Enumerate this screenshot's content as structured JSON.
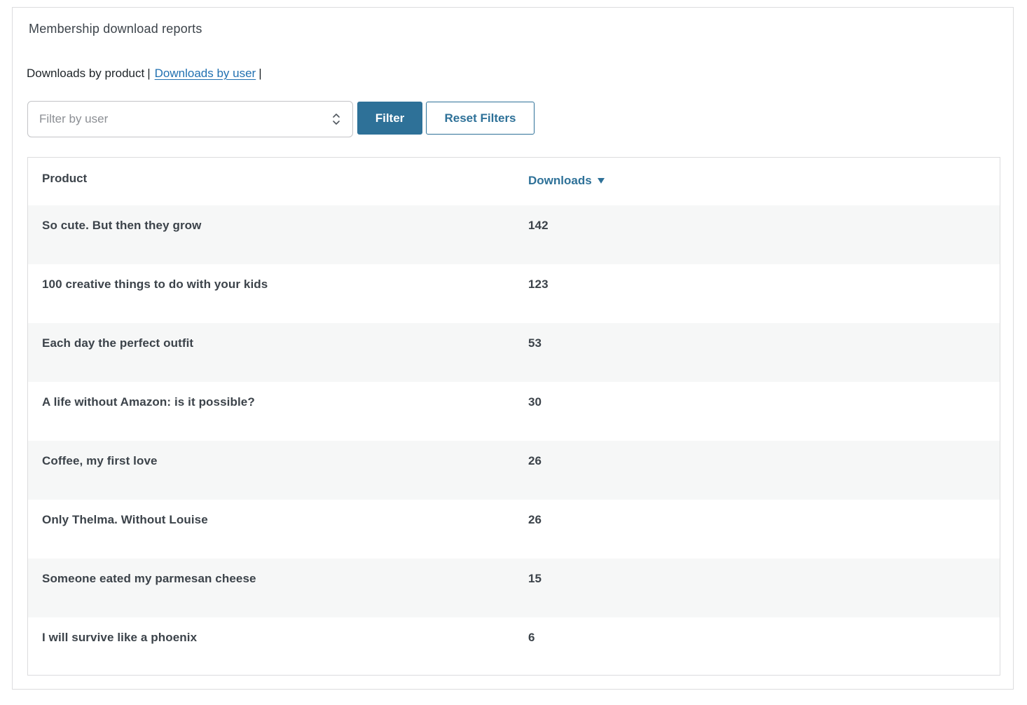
{
  "report": {
    "title": "Membership download reports"
  },
  "tabs": {
    "by_product": "Downloads by product",
    "separator": "|",
    "by_user": "Downloads by user",
    "trailing_separator": "|"
  },
  "filters": {
    "user_placeholder": "Filter by user",
    "filter_label": "Filter",
    "reset_label": "Reset Filters"
  },
  "table": {
    "columns": {
      "product": "Product",
      "downloads": "Downloads"
    },
    "sort": {
      "column": "downloads",
      "direction": "descending",
      "icon": "caret-down-icon"
    },
    "rows": [
      {
        "product": "So cute. But then they grow",
        "downloads": "142"
      },
      {
        "product": "100 creative things to do with your kids",
        "downloads": "123"
      },
      {
        "product": "Each day the perfect outfit",
        "downloads": "53"
      },
      {
        "product": "A life without Amazon: is it possible?",
        "downloads": "30"
      },
      {
        "product": "Coffee, my first love",
        "downloads": "26"
      },
      {
        "product": "Only Thelma. Without Louise",
        "downloads": "26"
      },
      {
        "product": "Someone eated my parmesan cheese",
        "downloads": "15"
      },
      {
        "product": "I will survive like a phoenix",
        "downloads": "6"
      }
    ]
  },
  "colors": {
    "accent": "#2e7198",
    "link": "#2271b1",
    "row_alt": "#f6f7f7",
    "border": "#dcdcde",
    "text": "#3c434a"
  }
}
